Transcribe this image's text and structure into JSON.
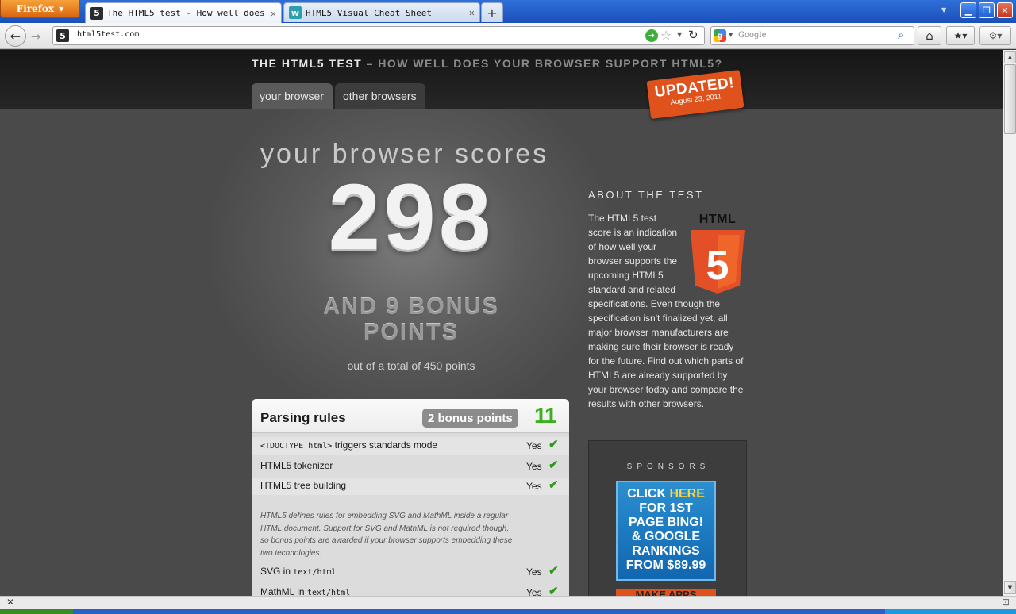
{
  "browser": {
    "app_button": "Firefox",
    "tabs": [
      {
        "title": "The HTML5 test - How well does y…",
        "favicon": "5",
        "favicon_color": "#2b2b2b",
        "active": true
      },
      {
        "title": "HTML5 Visual Cheat Sheet",
        "favicon": "w",
        "favicon_color": "#2a9fb0",
        "active": false
      }
    ],
    "url": "html5test.com",
    "search_placeholder": "Google"
  },
  "site": {
    "title_main": "THE HTML5 TEST",
    "title_sub": " – HOW WELL DOES YOUR BROWSER SUPPORT HTML5?",
    "nav": {
      "your_browser": "your browser",
      "other_browsers": "other browsers"
    },
    "badge": {
      "title": "UPDATED!",
      "date": "August 23, 2011",
      "color": "#e0521b"
    }
  },
  "score": {
    "heading": "your browser scores",
    "value": "298",
    "bonus_line1": "AND 9 BONUS",
    "bonus_line2": "POINTS",
    "total": "out of a total of 450 points"
  },
  "parsing": {
    "title": "Parsing rules",
    "bonus": "2 bonus points",
    "score": "11",
    "score_color": "#3bb01e",
    "rows": [
      {
        "code": "<!DOCTYPE html>",
        "label": " triggers standards mode",
        "result": "Yes"
      },
      {
        "code": "",
        "label": "HTML5 tokenizer",
        "result": "Yes"
      },
      {
        "code": "",
        "label": "HTML5 tree building",
        "result": "Yes"
      }
    ],
    "note": "HTML5 defines rules for embedding SVG and MathML inside a regular HTML document. Support for SVG and MathML is not required though, so bonus points are awarded if your browser supports embedding these two technologies.",
    "rows_extra": [
      {
        "label": "SVG in ",
        "code": "text/html",
        "result": "Yes"
      },
      {
        "label": "MathML in ",
        "code": "text/html",
        "result": "Yes"
      }
    ]
  },
  "about": {
    "title": "ABOUT THE TEST",
    "text": "The HTML5 test score is an indication of how well your browser supports the upcoming HTML5 standard and related specifications. Even though the specification isn't finalized yet, all major browser manufacturers are making sure their browser is ready for the future. Find out which parts of HTML5 are already supported by your browser today and compare the results with other browsers.",
    "logo_word": "HTML",
    "logo_number": "5"
  },
  "sponsors": {
    "title": "SPONSORS",
    "ad1": {
      "line1a": "CLICK ",
      "line1b": "HERE",
      "line2": "FOR 1ST",
      "line3": "PAGE BING!",
      "line4": "& GOOGLE",
      "line5": "RANKINGS",
      "line6": "FROM $89.99"
    },
    "ad2": "MAKE APPS"
  }
}
